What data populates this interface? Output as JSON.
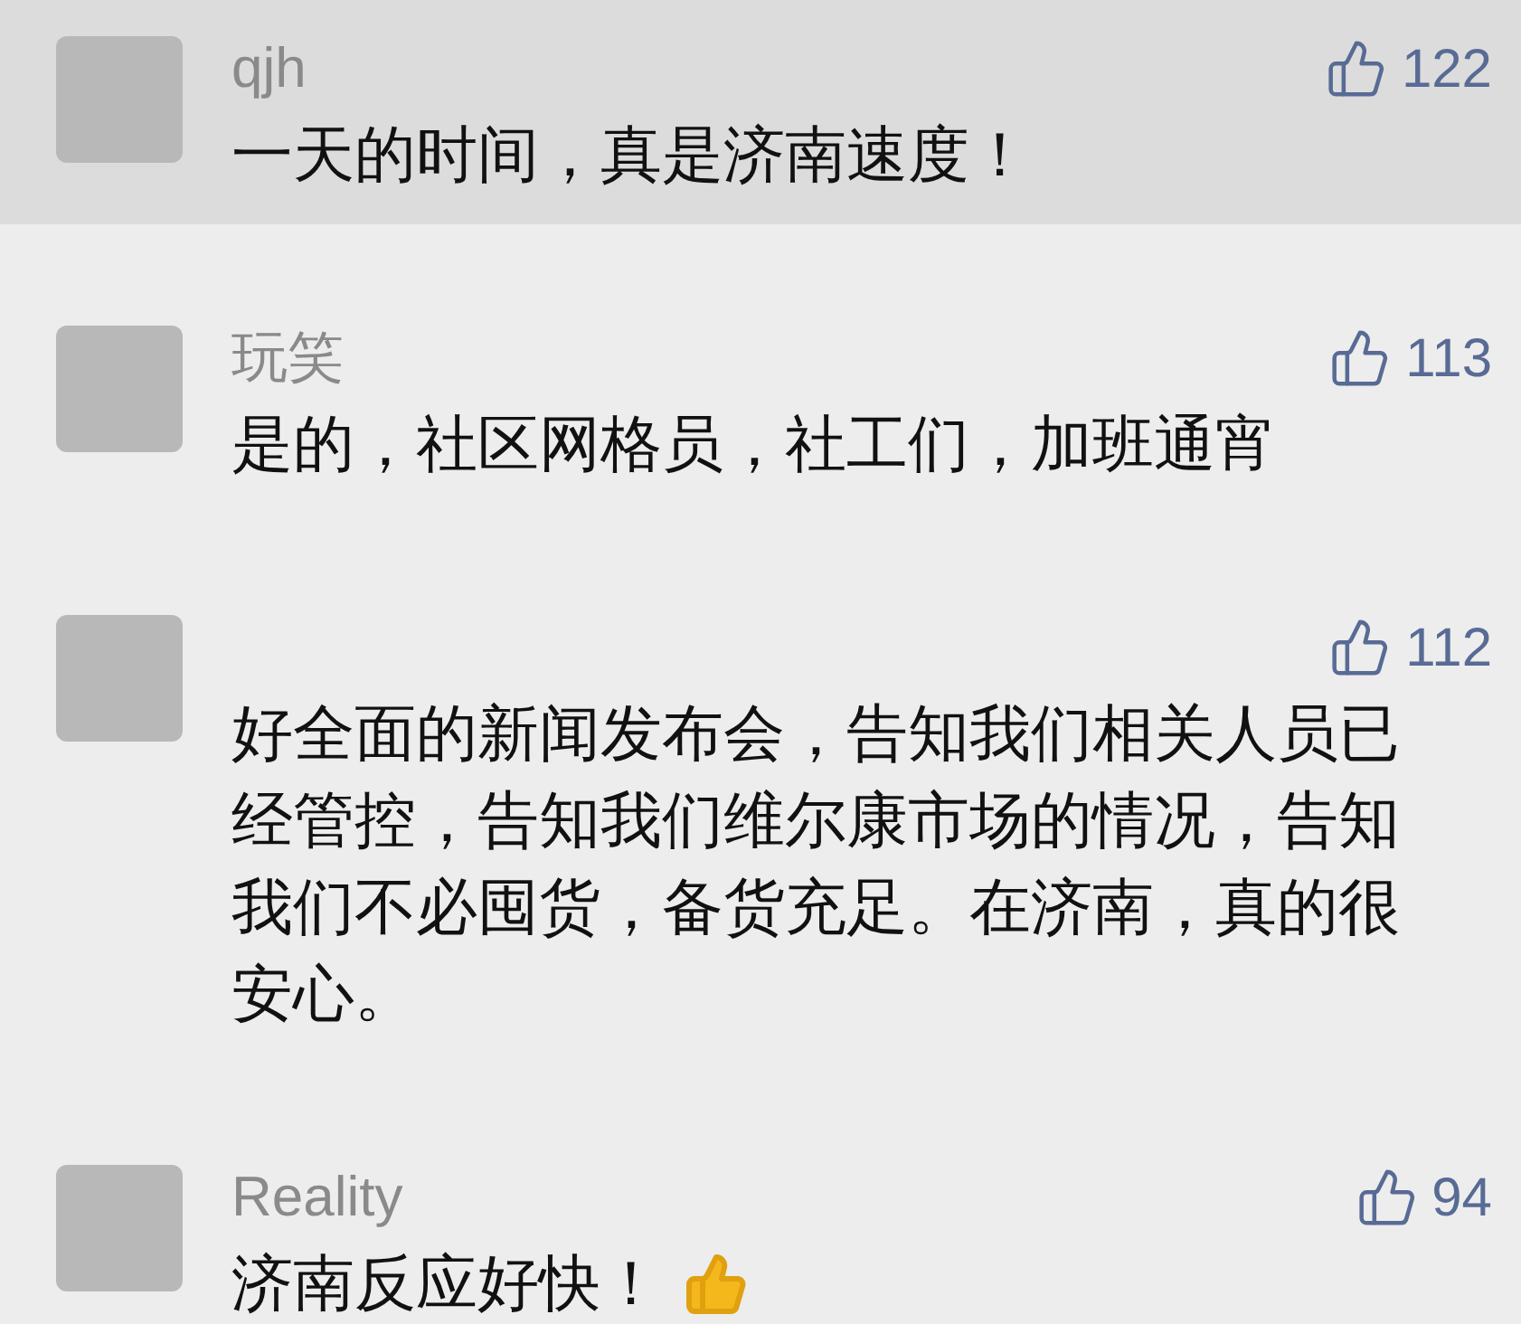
{
  "comments": [
    {
      "name": "qjh",
      "likes": "122",
      "text": "一天的时间，真是济南速度！",
      "highlighted": true,
      "emoji": false
    },
    {
      "name": "玩笑",
      "likes": "113",
      "text": "是的，社区网格员，社工们，加班通宵",
      "highlighted": false,
      "emoji": false
    },
    {
      "likes": "112",
      "text": "好全面的新闻发布会，告知我们相关人员已经管控，告知我们维尔康市场的情况，告知我们不必囤货，备货充足。在济南，真的很安心。",
      "highlighted": false,
      "emoji": false
    },
    {
      "name": "Reality",
      "likes": "94",
      "text": "济南反应好快！",
      "highlighted": false,
      "emoji": true
    }
  ]
}
